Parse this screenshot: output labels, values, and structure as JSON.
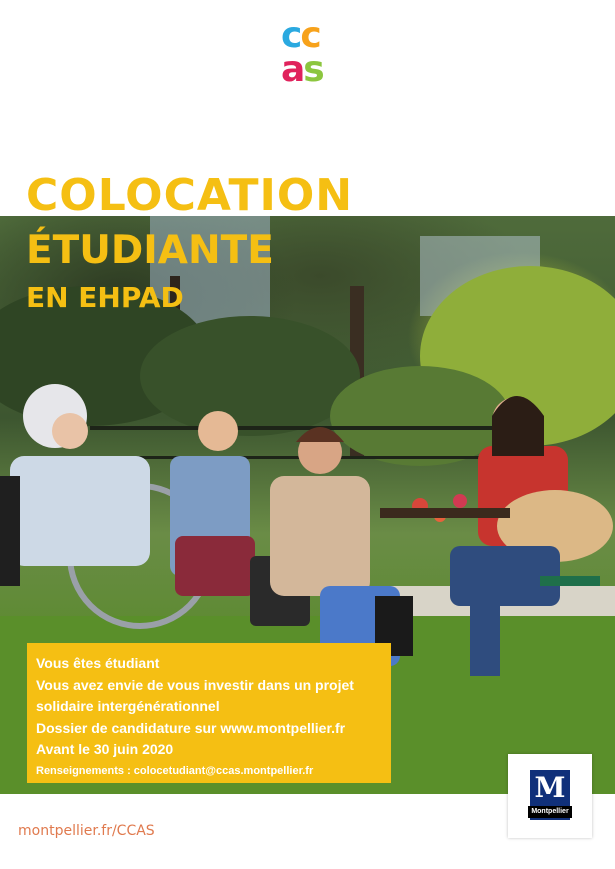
{
  "logo": {
    "line1_c1": "c",
    "line1_c2": "c",
    "line2_a": "a",
    "line2_s": "s"
  },
  "title": {
    "line1": "COLOCATION",
    "line2": "ÉTUDIANTE",
    "line3": "EN EHPAD"
  },
  "info": {
    "line1": "Vous êtes étudiant",
    "line2": "Vous avez envie de vous investir dans un projet",
    "line3": "solidaire intergénérationnel",
    "line4": "Dossier de candidature sur www.montpellier.fr",
    "line5": "Avant le 30 juin 2020",
    "line6": "Renseignements : colocetudiant@ccas.montpellier.fr"
  },
  "badge": {
    "letter": "M",
    "name": "Montpellier"
  },
  "footer": {
    "url": "montpellier.fr/CCAS"
  },
  "colors": {
    "yellow": "#f5bf13",
    "orange_footer": "#e07a4e",
    "navy": "#10307a"
  }
}
